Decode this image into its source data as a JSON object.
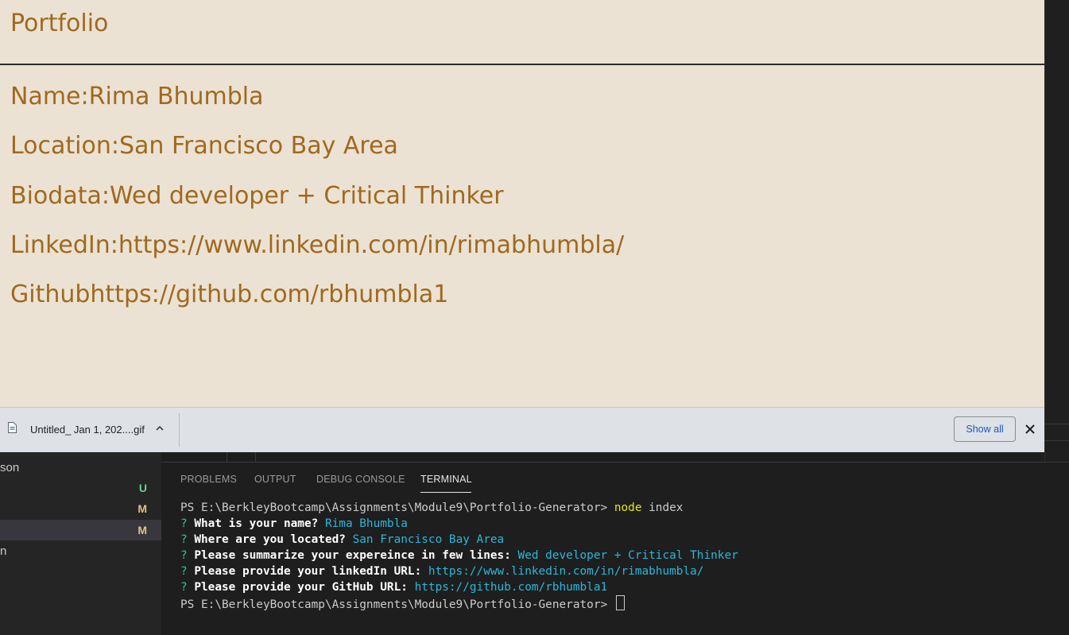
{
  "portfolio": {
    "title": "Portfolio",
    "lines": [
      "Name:Rima Bhumbla",
      "Location:San Francisco Bay Area",
      "Biodata:Wed developer + Critical Thinker",
      "LinkedIn:https://www.linkedin.com/in/rimabhumbla/",
      "Githubhttps://github.com/rbhumbla1"
    ],
    "text_color": "#a0691f",
    "background": "#ebe2d3"
  },
  "download_bar": {
    "filename": "Untitled_ Jan 1, 202....gif",
    "show_all_label": "Show all",
    "icons": [
      "file-icon",
      "chevron-up-icon",
      "close-icon"
    ]
  },
  "explorer": {
    "rows": [
      {
        "label": "son",
        "badge": ""
      },
      {
        "label": "",
        "badge": "U",
        "badge_color": "#73c991"
      },
      {
        "label": "",
        "badge": "M",
        "badge_color": "#e2c08d"
      },
      {
        "label": "",
        "badge": "M",
        "badge_color": "#e2c08d",
        "selected": true
      },
      {
        "label": "n",
        "badge": ""
      }
    ]
  },
  "panel": {
    "tabs": [
      "PROBLEMS",
      "OUTPUT",
      "DEBUG CONSOLE",
      "TERMINAL"
    ],
    "active_tab": "TERMINAL"
  },
  "terminal": {
    "prompt": "PS E:\\BerkleyBootcamp\\Assignments\\Module9\\Portfolio-Generator> ",
    "command_name": "node",
    "command_arg": " index",
    "qa": [
      {
        "q": "What is your name? ",
        "a": "Rima Bhumbla"
      },
      {
        "q": "Where are you located? ",
        "a": "San Francisco Bay Area"
      },
      {
        "q": "Please summarize your expereince in few lines: ",
        "a": "Wed developer + Critical Thinker"
      },
      {
        "q": "Please provide your linkedIn URL: ",
        "a": "https://www.linkedin.com/in/rimabhumbla/"
      },
      {
        "q": "Please provide your GitHub URL: ",
        "a": "https://github.com/rbhumbla1"
      }
    ],
    "question_mark": "? "
  }
}
